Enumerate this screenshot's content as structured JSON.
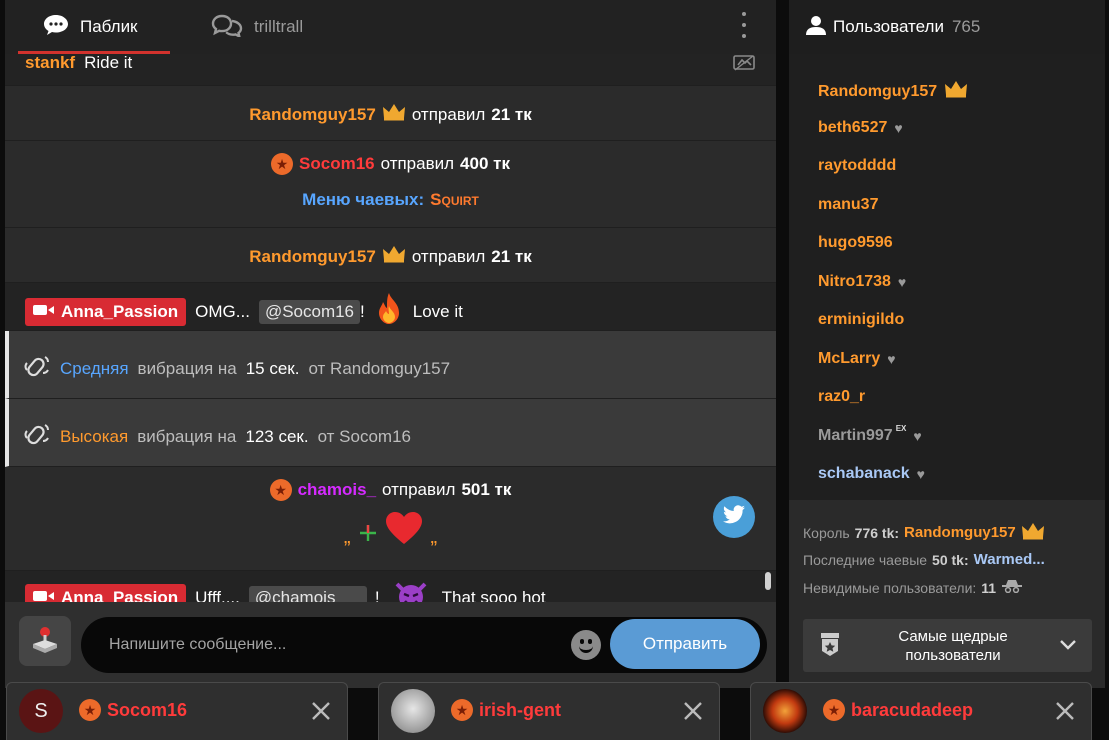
{
  "tabs": {
    "public": "Паблик",
    "private": "trilltrall"
  },
  "messages": {
    "m0": {
      "user": "stankf",
      "text": "Ride it"
    },
    "m1": {
      "user": "Randomguy157",
      "verb": "отправил",
      "amount": "21 тк"
    },
    "m2": {
      "user": "Socom16",
      "verb": "отправил",
      "amount": "400 тк",
      "menu_label": "Меню чаевых:",
      "menu_item": "Squirt"
    },
    "m3": {
      "user": "Randomguy157",
      "verb": "отправил",
      "amount": "21 тк"
    },
    "m4": {
      "user": "Anna_Passion",
      "pre": "OMG...",
      "mention": "@Socom16",
      "bang": "!",
      "post": "Love it"
    },
    "m5": {
      "level": "Средняя",
      "t1": "вибрация на",
      "secs": "15 сек.",
      "from": "от Randomguy157"
    },
    "m6": {
      "level": "Высокая",
      "t1": "вибрация на",
      "secs": "123 сек.",
      "from": "от Socom16"
    },
    "m7": {
      "user": "chamois_",
      "verb": "отправил",
      "amount": "501 тк",
      "open_q": "„",
      "close_q": "„"
    },
    "m8": {
      "user": "Anna_Passion",
      "pre": "Ufff....",
      "mention": "@chamois",
      "bang": "!",
      "post": "That sooo hot"
    }
  },
  "composer": {
    "placeholder": "Напишите сообщение...",
    "send": "Отправить"
  },
  "users": {
    "title": "Пользователи",
    "count": "765",
    "list": [
      {
        "name": "Randomguy157",
        "color": "#ff9a2e"
      },
      {
        "name": "beth6527",
        "color": "#ff9a2e"
      },
      {
        "name": "raytodddd",
        "color": "#ff9a2e"
      },
      {
        "name": "manu37",
        "color": "#ff9a2e"
      },
      {
        "name": "hugo9596",
        "color": "#ff9a2e"
      },
      {
        "name": "Nitro1738",
        "color": "#ff9a2e"
      },
      {
        "name": "erminigildo",
        "color": "#ff9a2e"
      },
      {
        "name": "McLarry",
        "color": "#ff9a2e"
      },
      {
        "name": "raz0_r",
        "color": "#ff9a2e"
      },
      {
        "name": "Martin997",
        "sup": "EX",
        "color": "#9a9a9a"
      },
      {
        "name": "schabanack",
        "color": "#a9c8f5"
      }
    ],
    "king": {
      "label": "Король",
      "amount": "776 tk:",
      "name": "Randomguy157"
    },
    "last_tip": {
      "label": "Последние чаевые",
      "amount": "50 tk:",
      "name": "Warmed..."
    },
    "invisible": {
      "label": "Невидимые пользователи:",
      "count": "11"
    },
    "generous_btn": "Самые щедрые пользователи"
  },
  "private_tabs": [
    {
      "avatar_letter": "S",
      "name": "Socom16"
    },
    {
      "avatar_letter": "",
      "name": "irish-gent"
    },
    {
      "avatar_letter": "",
      "name": "baracudadeep"
    }
  ]
}
